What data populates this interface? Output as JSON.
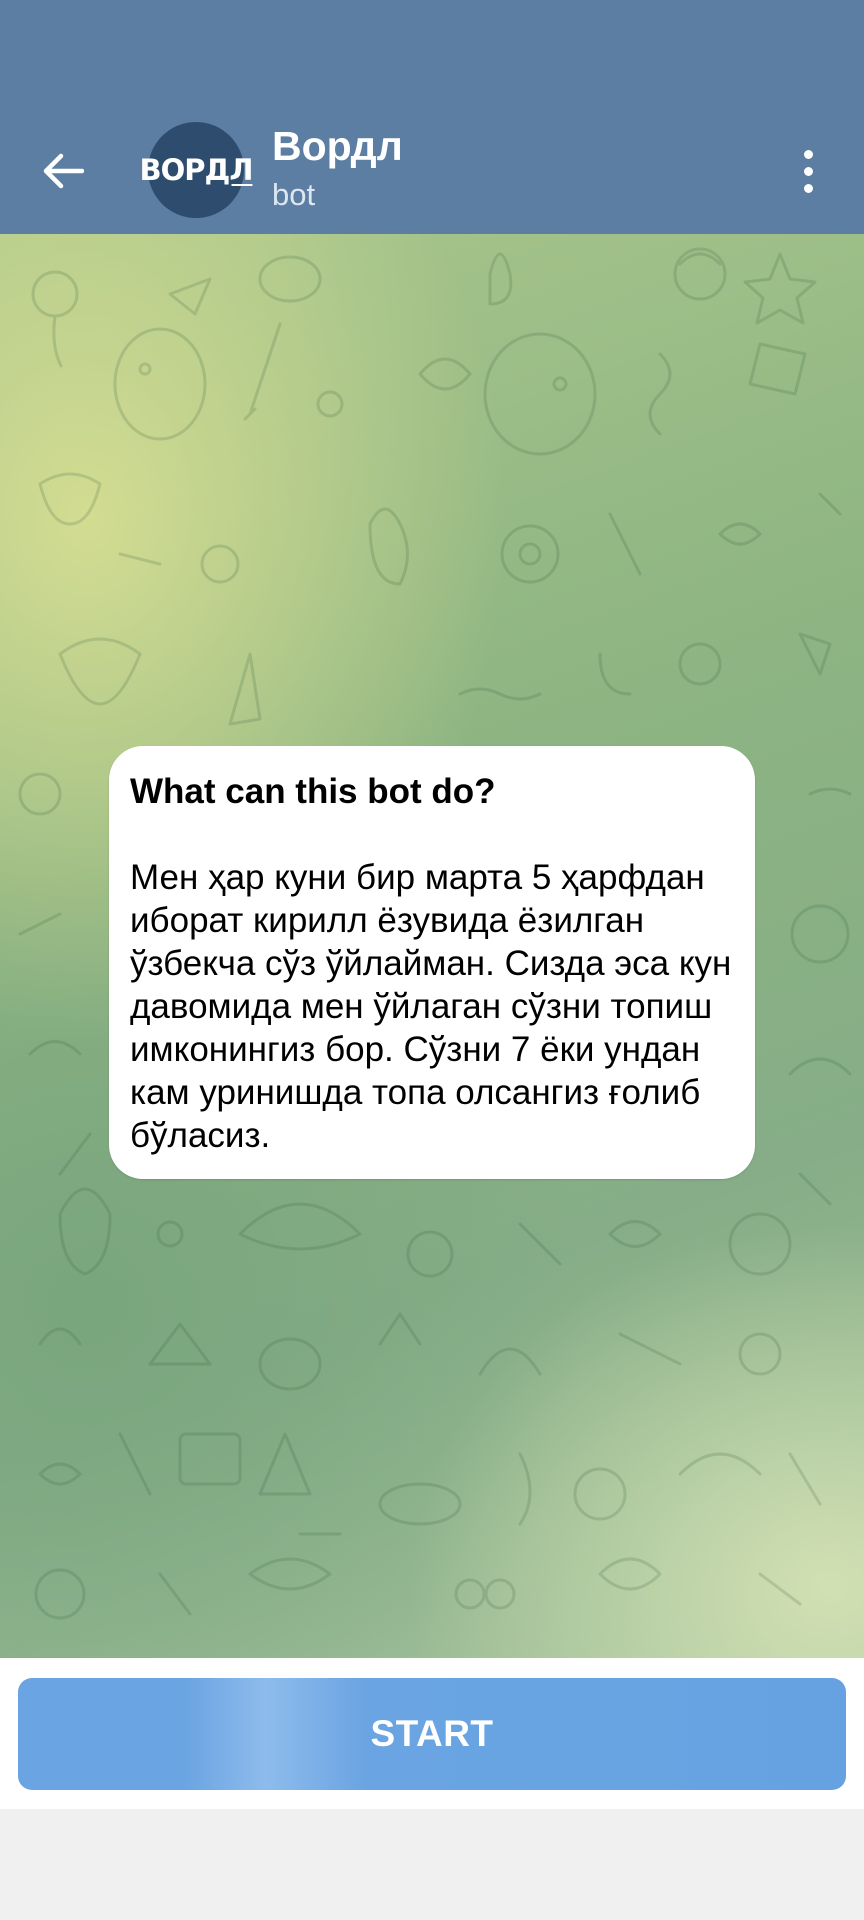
{
  "header": {
    "back_icon": "arrow-left-icon",
    "avatar_text_a": "ВОР",
    "avatar_text_b": "ДЛ",
    "title": "Вордл",
    "subtitle": "bot",
    "menu_icon": "more-vertical-icon"
  },
  "chat": {
    "background": "doodle-pattern",
    "intro": {
      "title": "What can this bot do?",
      "text": "Мен ҳар куни бир марта 5 ҳарфдан иборат кирилл ёзувида ёзилган ўзбекча сўз ўйлайман. Сизда эса кун давомида мен ўйлаган сўзни топиш имконингиз бор. Сўзни 7 ёки ундан кам уринишда топа олсангиз ғолиб бўласиз."
    }
  },
  "footer": {
    "start_label": "START"
  },
  "colors": {
    "header": "#5b7ea2",
    "avatar": "#2e4c6e",
    "start_button": "#6aa4e2"
  }
}
